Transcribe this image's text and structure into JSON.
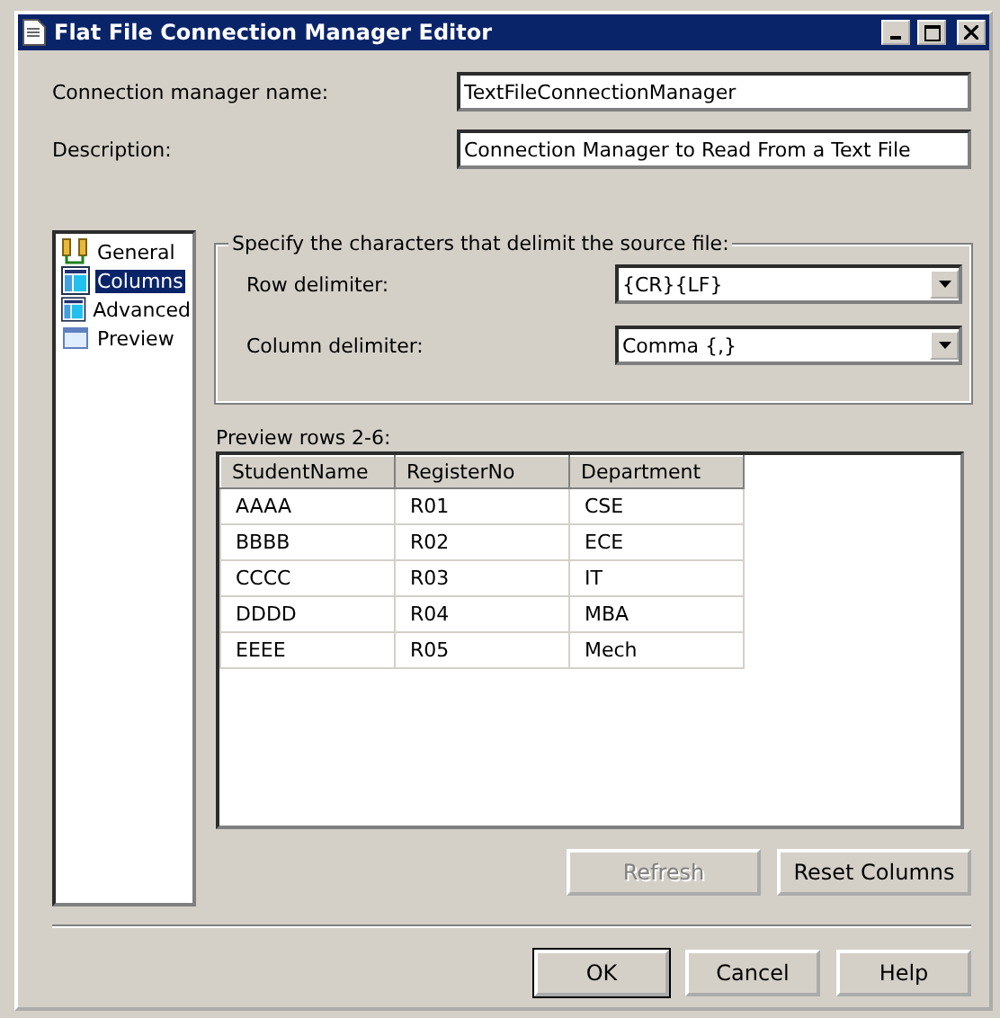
{
  "window": {
    "title": "Flat File Connection Manager Editor"
  },
  "fields": [
    {
      "label": "Connection manager name:",
      "value": "TextFileConnectionManager"
    },
    {
      "label": "Description:",
      "value": "Connection Manager to Read From a Text File"
    }
  ],
  "sidebar": {
    "items": [
      {
        "label": "General",
        "kind": "general",
        "selected": false
      },
      {
        "label": "Columns",
        "kind": "grid",
        "selected": true
      },
      {
        "label": "Advanced",
        "kind": "grid",
        "selected": false
      },
      {
        "label": "Preview",
        "kind": "preview",
        "selected": false
      }
    ]
  },
  "delimiters": {
    "title": "Specify the characters that delimit the source file:",
    "items": [
      {
        "label": "Row delimiter:",
        "value": "{CR}{LF}"
      },
      {
        "label": "Column delimiter:",
        "value": "Comma {,}"
      }
    ]
  },
  "preview": {
    "label": "Preview rows 2-6:",
    "columns": [
      "StudentName",
      "RegisterNo",
      "Department"
    ],
    "rows": [
      [
        "AAAA",
        "R01",
        "CSE"
      ],
      [
        "BBBB",
        "R02",
        "ECE"
      ],
      [
        "CCCC",
        "R03",
        "IT"
      ],
      [
        "DDDD",
        "R04",
        "MBA"
      ],
      [
        "EEEE",
        "R05",
        "Mech"
      ]
    ]
  },
  "actions": [
    {
      "label": "Refresh",
      "disabled": true
    },
    {
      "label": "Reset Columns",
      "disabled": false
    }
  ],
  "buttons": [
    {
      "label": "OK",
      "default": true
    },
    {
      "label": "Cancel",
      "default": false
    },
    {
      "label": "Help",
      "default": false
    }
  ]
}
